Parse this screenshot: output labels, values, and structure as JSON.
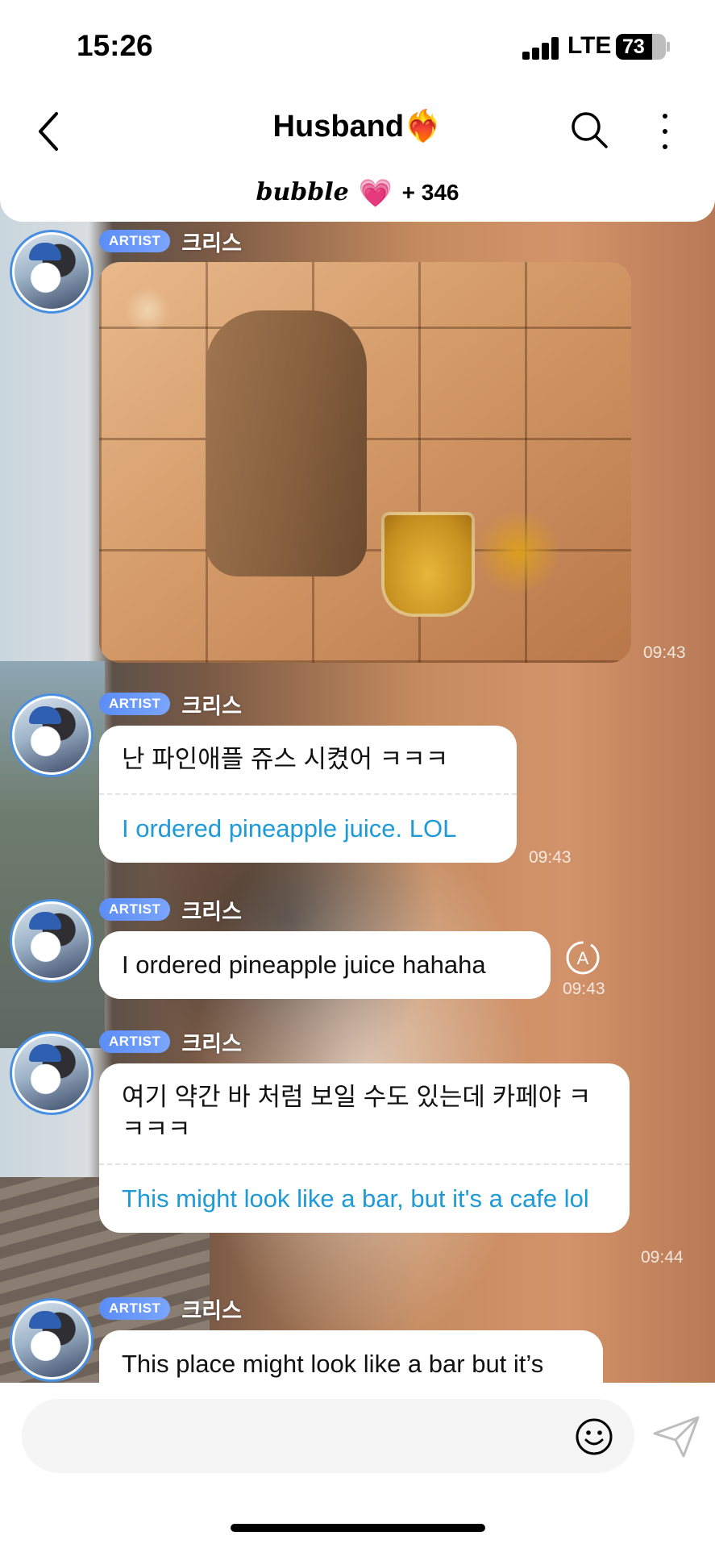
{
  "status_bar": {
    "time": "15:26",
    "network": "LTE",
    "battery": "73"
  },
  "header": {
    "title": "Husband",
    "title_emoji": "❤️‍🔥",
    "app_logo": "bubble",
    "heart": "💗",
    "plus_count": "+ 346"
  },
  "messages": [
    {
      "badge": "ARTIST",
      "sender": "크리스",
      "type": "image",
      "time": "09:43"
    },
    {
      "badge": "ARTIST",
      "sender": "크리스",
      "type": "text_translated",
      "original": "난 파인애플 쥬스 시켰어 ㅋㅋㅋ",
      "translation": "I ordered pineapple juice. LOL",
      "time": "09:43"
    },
    {
      "badge": "ARTIST",
      "sender": "크리스",
      "type": "text",
      "text": "I ordered pineapple juice hahaha",
      "time": "09:43"
    },
    {
      "badge": "ARTIST",
      "sender": "크리스",
      "type": "text_translated",
      "original": "여기 약간 바 처럼 보일 수도 있는데 카페야 ㅋㅋㅋㅋ",
      "translation": "This might look like a bar, but it's a cafe lol",
      "time": "09:44"
    },
    {
      "badge": "ARTIST",
      "sender": "크리스",
      "type": "text",
      "text": "This place might look like a bar but it’s"
    }
  ],
  "colors": {
    "artist_badge": "#5b8df6",
    "translation_text": "#1e9bd7",
    "avatar_ring": "#4a90e2"
  }
}
